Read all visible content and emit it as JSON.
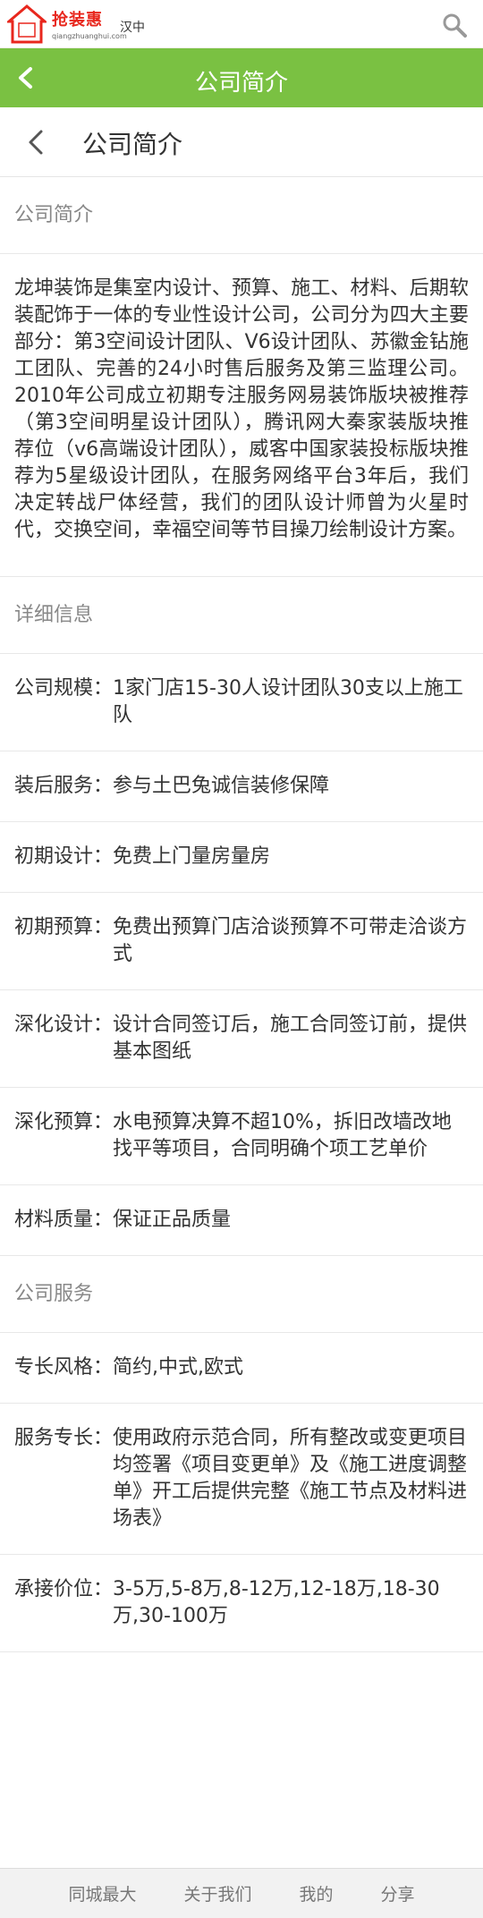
{
  "brand": {
    "name": "抢装惠",
    "url": "qiangzhuanghui.com",
    "logo_text": "抢装惠",
    "city": "汉中"
  },
  "header": {
    "title": "公司简介"
  },
  "subheader": {
    "title": "公司简介"
  },
  "intro": {
    "section_title": "公司简介",
    "text": "龙坤装饰是集室内设计、预算、施工、材料、后期软装配饰于一体的专业性设计公司，公司分为四大主要部分：第3空间设计团队、V6设计团队、苏徽金钻施工团队、完善的24小时售后服务及第三监理公司。2010年公司成立初期专注服务网易装饰版块被推荐（第3空间明星设计团队），腾讯网大秦家装版块推荐位（v6高端设计团队），威客中国家装投标版块推荐为5星级设计团队，在服务网络平台3年后，我们决定转战尸体经营，我们的团队设计师曾为火星时代，交换空间，幸福空间等节目操刀绘制设计方案。"
  },
  "details": {
    "section_title": "详细信息",
    "rows": [
      {
        "key": "公司规模：",
        "value": "1家门店15-30人设计团队30支以上施工队"
      },
      {
        "key": "装后服务：",
        "value": "参与土巴兔诚信装修保障"
      },
      {
        "key": "初期设计：",
        "value": "免费上门量房量房"
      },
      {
        "key": "初期预算：",
        "value": "免费出预算门店洽谈预算不可带走洽谈方式"
      },
      {
        "key": "深化设计：",
        "value": "设计合同签订后，施工合同签订前，提供基本图纸"
      },
      {
        "key": "深化预算：",
        "value": "水电预算决算不超10%，拆旧改墙改地找平等项目，合同明确个项工艺单价"
      },
      {
        "key": "材料质量：",
        "value": "保证正品质量"
      }
    ]
  },
  "services": {
    "section_title": "公司服务",
    "rows": [
      {
        "key": "专长风格：",
        "value": "简约,中式,欧式"
      },
      {
        "key": "服务专长：",
        "value": "使用政府示范合同，所有整改或变更项目均签署《项目变更单》及《施工进度调整单》开工后提供完整《施工节点及材料进场表》"
      },
      {
        "key": "承接价位：",
        "value": "3-5万,5-8万,8-12万,12-18万,18-30万,30-100万"
      }
    ]
  },
  "bottom_nav": {
    "items": [
      {
        "label": "同城最大"
      },
      {
        "label": "关于我们"
      },
      {
        "label": "我的"
      },
      {
        "label": "分享"
      }
    ]
  },
  "colors": {
    "accent_green": "#7ac142",
    "brand_red": "#e8271d"
  }
}
